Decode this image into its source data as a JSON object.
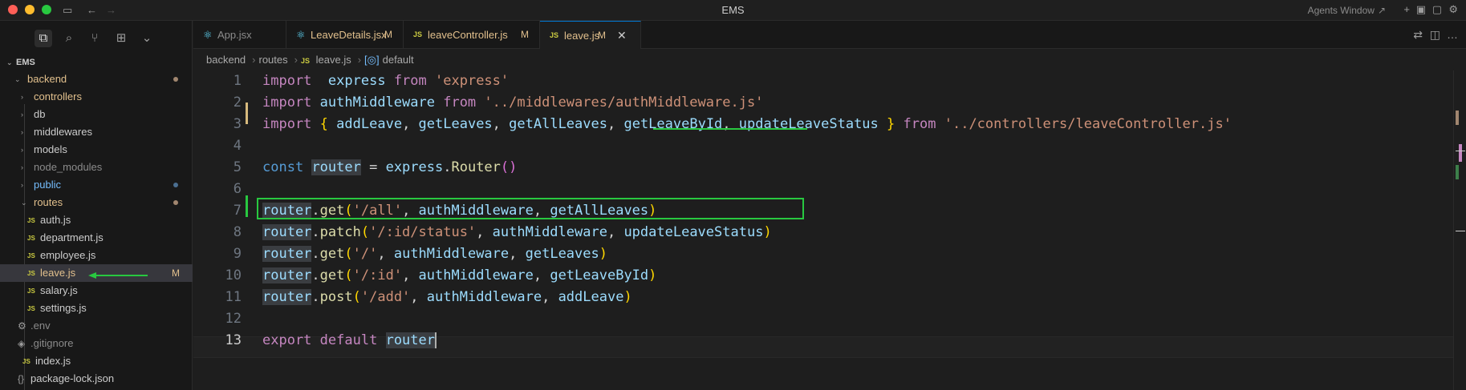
{
  "window": {
    "title": "EMS",
    "agents_label": "Agents Window",
    "agents_arrow": "↗"
  },
  "titlebar_icons": {
    "sidebar_toggle": "▭",
    "back": "←",
    "forward": "→",
    "new": "+",
    "layout1": "▣",
    "layout2": "▢",
    "settings": "⚙"
  },
  "activity": {
    "explorer": "⧉",
    "search": "⌕",
    "source_control": "⑂",
    "extensions": "⊞",
    "more": "⌄"
  },
  "explorer": {
    "root_label": "EMS",
    "root_twisty": "⌄",
    "items": [
      {
        "label": "backend",
        "kind": "folder",
        "twisty": "⌄",
        "dot": true,
        "color": "#e2c08d"
      },
      {
        "label": "controllers",
        "kind": "folder",
        "twisty": "›",
        "color": "#e2c08d"
      },
      {
        "label": "db",
        "kind": "folder",
        "twisty": "›",
        "color": "#cccccc"
      },
      {
        "label": "middlewares",
        "kind": "folder",
        "twisty": "›",
        "color": "#cccccc"
      },
      {
        "label": "models",
        "kind": "folder",
        "twisty": "›",
        "color": "#cccccc"
      },
      {
        "label": "node_modules",
        "kind": "folder",
        "twisty": "›",
        "color": "#8b8b8b"
      },
      {
        "label": "public",
        "kind": "folder",
        "twisty": "›",
        "dot": true,
        "color": "#75beff"
      },
      {
        "label": "routes",
        "kind": "folder",
        "twisty": "⌄",
        "dot": true,
        "color": "#e2c08d"
      },
      {
        "label": "auth.js",
        "kind": "js",
        "color": "#cccccc"
      },
      {
        "label": "department.js",
        "kind": "js",
        "color": "#cccccc"
      },
      {
        "label": "employee.js",
        "kind": "js",
        "color": "#cccccc"
      },
      {
        "label": "leave.js",
        "kind": "js",
        "modified": "M",
        "color": "#e2c08d",
        "selected": true
      },
      {
        "label": "salary.js",
        "kind": "js",
        "color": "#cccccc"
      },
      {
        "label": "settings.js",
        "kind": "js",
        "color": "#cccccc"
      },
      {
        "label": ".env",
        "kind": "gear",
        "icon": "⚙",
        "color": "#8b8b8b"
      },
      {
        "label": ".gitignore",
        "kind": "git",
        "icon": "◈",
        "color": "#8b8b8b"
      },
      {
        "label": "index.js",
        "kind": "js",
        "color": "#cccccc"
      },
      {
        "label": "package-lock.json",
        "kind": "json",
        "icon": "{}",
        "color": "#cccccc"
      }
    ],
    "js_badge": "JS"
  },
  "tabs": [
    {
      "label": "App.jsx",
      "icon": "⚛",
      "icon_color": "#61dafb",
      "modified": "",
      "color": "#8b8b8b"
    },
    {
      "label": "LeaveDetails.jsx",
      "icon": "⚛",
      "icon_color": "#61dafb",
      "modified": "M",
      "color": "#e2c08d"
    },
    {
      "label": "leaveController.js",
      "icon": "JS",
      "icon_color": "#cbcb41",
      "modified": "M",
      "color": "#e2c08d"
    },
    {
      "label": "leave.js",
      "icon": "JS",
      "icon_color": "#cbcb41",
      "modified": "M",
      "color": "#e2c08d",
      "active": true,
      "close": "✕"
    }
  ],
  "tab_actions": {
    "compare": "⇄",
    "split": "◫",
    "more": "…"
  },
  "breadcrumb": {
    "parts": [
      "backend",
      "routes",
      "leave.js",
      "default"
    ],
    "sep": "›",
    "js_badge": "JS",
    "sym_icon": "[◎]"
  },
  "editor": {
    "lines": [
      {
        "n": "1",
        "tokens": [
          [
            "kw",
            "import"
          ],
          [
            "",
            "  "
          ],
          [
            "var",
            "express"
          ],
          [
            "",
            " "
          ],
          [
            "kw",
            "from"
          ],
          [
            "",
            " "
          ],
          [
            "str",
            "'express'"
          ]
        ]
      },
      {
        "n": "2",
        "tokens": [
          [
            "kw",
            "import"
          ],
          [
            "",
            " "
          ],
          [
            "var",
            "authMiddleware"
          ],
          [
            "",
            " "
          ],
          [
            "kw",
            "from"
          ],
          [
            "",
            " "
          ],
          [
            "str",
            "'../middlewares/authMiddleware.js'"
          ]
        ]
      },
      {
        "n": "3",
        "tokens": [
          [
            "kw",
            "import"
          ],
          [
            "",
            " "
          ],
          [
            "brace",
            "{"
          ],
          [
            "",
            " "
          ],
          [
            "var",
            "addLeave"
          ],
          [
            "",
            ", "
          ],
          [
            "var",
            "getLeaves"
          ],
          [
            "",
            ", "
          ],
          [
            "var",
            "getAllLeaves"
          ],
          [
            "",
            ", "
          ],
          [
            "var",
            "getLeaveById"
          ],
          [
            "",
            ", "
          ],
          [
            "var",
            "updateLeaveStatus"
          ],
          [
            "",
            " "
          ],
          [
            "brace",
            "}"
          ],
          [
            "",
            " "
          ],
          [
            "kw",
            "from"
          ],
          [
            "",
            " "
          ],
          [
            "str",
            "'../controllers/leaveController.js'"
          ]
        ]
      },
      {
        "n": "4",
        "tokens": []
      },
      {
        "n": "5",
        "tokens": [
          [
            "kw2",
            "const"
          ],
          [
            "",
            " "
          ],
          [
            "var hlword",
            "router"
          ],
          [
            "",
            " = "
          ],
          [
            "var",
            "express"
          ],
          [
            ".",
            ""
          ],
          [
            "",
            "."
          ],
          [
            "fn",
            "Router"
          ],
          [
            "paren",
            "()"
          ]
        ]
      },
      {
        "n": "6",
        "tokens": []
      },
      {
        "n": "7",
        "tokens": [
          [
            "var hlword",
            "router"
          ],
          [
            "",
            "."
          ],
          [
            "fn",
            "get"
          ],
          [
            "brace",
            "("
          ],
          [
            "str",
            "'/all'"
          ],
          [
            "",
            ", "
          ],
          [
            "var",
            "authMiddleware"
          ],
          [
            "",
            ", "
          ],
          [
            "var",
            "getAllLeaves"
          ],
          [
            "brace",
            ")"
          ]
        ]
      },
      {
        "n": "8",
        "tokens": [
          [
            "var hlword",
            "router"
          ],
          [
            "",
            "."
          ],
          [
            "fn",
            "patch"
          ],
          [
            "brace",
            "("
          ],
          [
            "str",
            "'/:id/status'"
          ],
          [
            "",
            ", "
          ],
          [
            "var",
            "authMiddleware"
          ],
          [
            "",
            ", "
          ],
          [
            "var",
            "updateLeaveStatus"
          ],
          [
            "brace",
            ")"
          ]
        ]
      },
      {
        "n": "9",
        "tokens": [
          [
            "var hlword",
            "router"
          ],
          [
            "",
            "."
          ],
          [
            "fn",
            "get"
          ],
          [
            "brace",
            "("
          ],
          [
            "str",
            "'/'"
          ],
          [
            "",
            ", "
          ],
          [
            "var",
            "authMiddleware"
          ],
          [
            "",
            ", "
          ],
          [
            "var",
            "getLeaves"
          ],
          [
            "brace",
            ")"
          ]
        ]
      },
      {
        "n": "10",
        "tokens": [
          [
            "var hlword",
            "router"
          ],
          [
            "",
            "."
          ],
          [
            "fn",
            "get"
          ],
          [
            "brace",
            "("
          ],
          [
            "str",
            "'/:id'"
          ],
          [
            "",
            ", "
          ],
          [
            "var",
            "authMiddleware"
          ],
          [
            "",
            ", "
          ],
          [
            "var",
            "getLeaveById"
          ],
          [
            "brace",
            ")"
          ]
        ]
      },
      {
        "n": "11",
        "tokens": [
          [
            "var hlword",
            "router"
          ],
          [
            "",
            "."
          ],
          [
            "fn",
            "post"
          ],
          [
            "brace",
            "("
          ],
          [
            "str",
            "'/add'"
          ],
          [
            "",
            ", "
          ],
          [
            "var",
            "authMiddleware"
          ],
          [
            "",
            ", "
          ],
          [
            "var",
            "addLeave"
          ],
          [
            "brace",
            ")"
          ]
        ]
      },
      {
        "n": "12",
        "tokens": []
      },
      {
        "n": "13",
        "tokens": [
          [
            "kw",
            "export"
          ],
          [
            "",
            " "
          ],
          [
            "kw",
            "default"
          ],
          [
            "",
            " "
          ],
          [
            "var hlword",
            "router"
          ]
        ],
        "current": true
      }
    ]
  },
  "colors": {
    "accent": "#0078d4",
    "annotation": "#28c840",
    "modified": "#e2c08d"
  }
}
